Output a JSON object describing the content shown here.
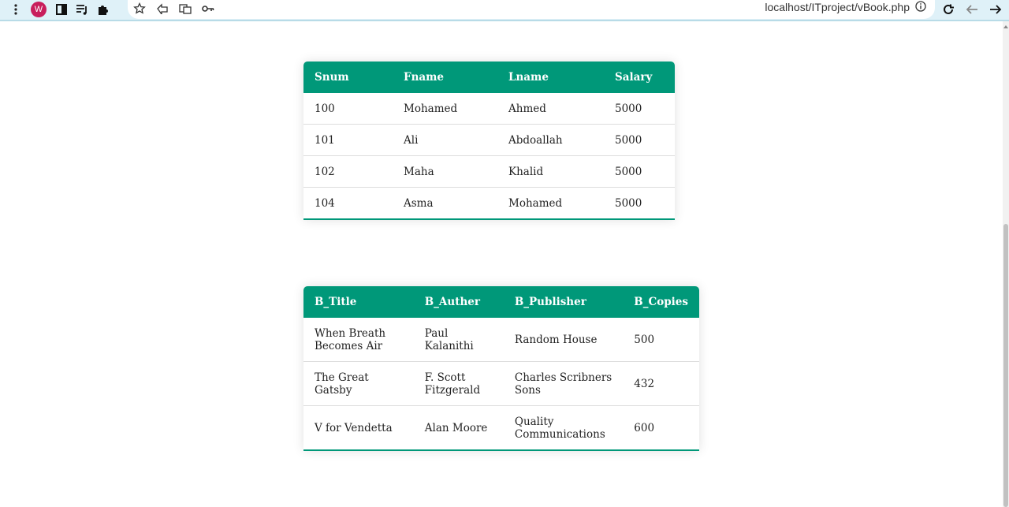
{
  "browser": {
    "url": "localhost/ITproject/vBook.php",
    "avatar_letter": "W",
    "avatar_color": "#c81e5c"
  },
  "employees": {
    "headers": [
      "Snum",
      "Fname",
      "Lname",
      "Salary"
    ],
    "rows": [
      [
        "100",
        "Mohamed",
        "Ahmed",
        "5000"
      ],
      [
        "101",
        "Ali",
        "Abdoallah",
        "5000"
      ],
      [
        "102",
        "Maha",
        "Khalid",
        "5000"
      ],
      [
        "104",
        "Asma",
        "Mohamed",
        "5000"
      ]
    ]
  },
  "books": {
    "headers": [
      "B_Title",
      "B_Auther",
      "B_Publisher",
      "B_Copies"
    ],
    "rows": [
      [
        "When Breath Becomes Air",
        "Paul Kalanithi",
        "Random House",
        "500"
      ],
      [
        "The Great Gatsby",
        "F. Scott Fitzgerald",
        "Charles Scribners Sons",
        "432"
      ],
      [
        "V for Vendetta",
        "Alan Moore",
        "Quality Communications",
        "600"
      ]
    ]
  },
  "colors": {
    "accent": "#009879"
  }
}
